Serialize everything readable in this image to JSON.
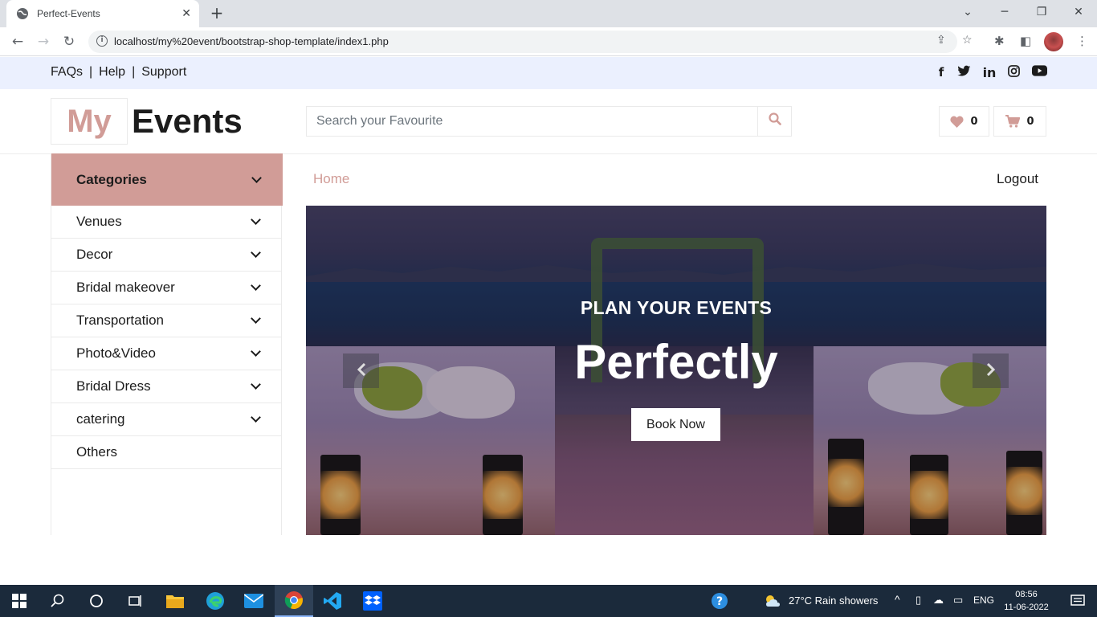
{
  "browser": {
    "tab_title": "Perfect-Events",
    "url": "localhost/my%20event/bootstrap-shop-template/index1.php"
  },
  "topbar": {
    "links": [
      "FAQs",
      "Help",
      "Support"
    ],
    "separator": "|",
    "social_icons": [
      "facebook-icon",
      "twitter-icon",
      "linkedin-icon",
      "instagram-icon",
      "youtube-icon"
    ],
    "social_glyphs": [
      "f",
      "🐦",
      "in",
      "◎",
      "▶"
    ]
  },
  "header": {
    "logo_part1": "My",
    "logo_part2": "Events",
    "search_placeholder": "Search your Favourite",
    "wishlist_count": "0",
    "cart_count": "0"
  },
  "sidebar": {
    "title": "Categories",
    "items": [
      {
        "label": "Venues",
        "has_dropdown": true
      },
      {
        "label": "Decor",
        "has_dropdown": true
      },
      {
        "label": "Bridal makeover",
        "has_dropdown": true
      },
      {
        "label": "Transportation",
        "has_dropdown": true
      },
      {
        "label": "Photo&Video",
        "has_dropdown": true
      },
      {
        "label": "Bridal Dress",
        "has_dropdown": true
      },
      {
        "label": "catering",
        "has_dropdown": true
      },
      {
        "label": "Others",
        "has_dropdown": false
      }
    ]
  },
  "nav": {
    "home": "Home",
    "logout": "Logout"
  },
  "hero": {
    "subtitle": "PLAN YOUR EVENTS",
    "title": "Perfectly",
    "button": "Book Now"
  },
  "taskbar": {
    "weather": "27°C  Rain showers",
    "language": "ENG",
    "time": "08:56",
    "date": "11-06-2022"
  },
  "colors": {
    "accent": "#d19c97",
    "topbar_bg": "#ebf0fe",
    "text": "#1c1c1c",
    "taskbar_bg": "#1b2a3b"
  }
}
